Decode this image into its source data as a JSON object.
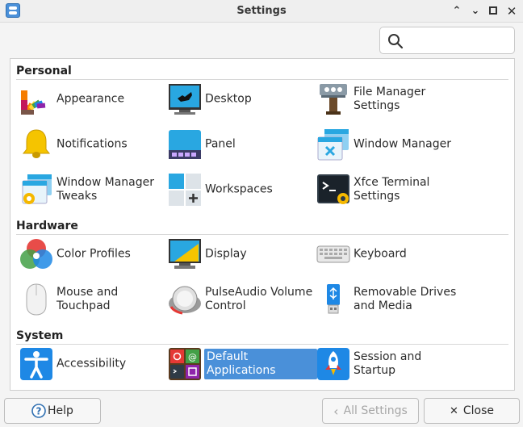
{
  "window": {
    "title": "Settings"
  },
  "search": {
    "placeholder": ""
  },
  "sections": {
    "personal": "Personal",
    "hardware": "Hardware",
    "system": "System"
  },
  "items": {
    "appearance": "Appearance",
    "desktop": "Desktop",
    "file_manager": "File Manager Settings",
    "notifications": "Notifications",
    "panel": "Panel",
    "window_manager": "Window Manager",
    "wm_tweaks": "Window Manager Tweaks",
    "workspaces": "Workspaces",
    "terminal": "Xfce Terminal Settings",
    "color_profiles": "Color Profiles",
    "display": "Display",
    "keyboard": "Keyboard",
    "mouse": "Mouse and Touchpad",
    "pulseaudio": "PulseAudio Volume Control",
    "removable": "Removable Drives and Media",
    "accessibility": "Accessibility",
    "default_apps": "Default Applications",
    "session": "Session and Startup"
  },
  "buttons": {
    "help": "Help",
    "all_settings": "All Settings",
    "close": "Close"
  },
  "selected_item": "default_apps",
  "colors": {
    "accent": "#4a90d9"
  }
}
